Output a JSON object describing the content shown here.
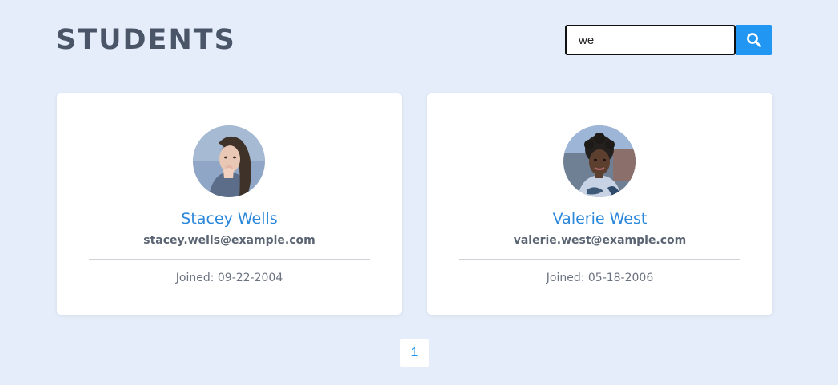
{
  "header": {
    "title": "STUDENTS"
  },
  "search": {
    "value": "we",
    "placeholder": "",
    "button_icon": "search-icon"
  },
  "students": [
    {
      "name": "Stacey Wells",
      "email": "stacey.wells@example.com",
      "joined": "Joined: 09-22-2004"
    },
    {
      "name": "Valerie West",
      "email": "valerie.west@example.com",
      "joined": "Joined: 05-18-2006"
    }
  ],
  "pagination": {
    "current_page": "1"
  },
  "colors": {
    "background": "#e5edfa",
    "accent": "#2196f3",
    "name_link": "#2b87da",
    "title": "#4a5568"
  }
}
